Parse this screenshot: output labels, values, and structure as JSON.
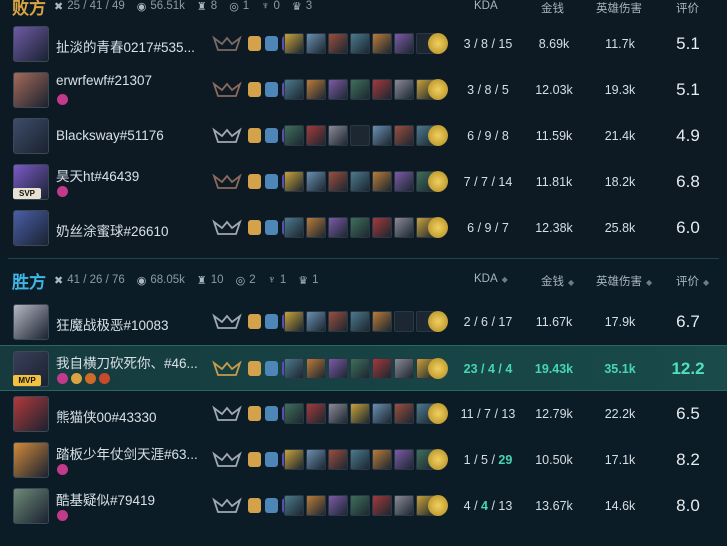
{
  "lose_team": {
    "label": "败方",
    "kills": "25 / 41 / 49",
    "gold": "56.51k",
    "towers": "8",
    "inhibitors": "1",
    "barons": "0",
    "dragons": "3",
    "columns": {
      "kda": "KDA",
      "gold": "金钱",
      "damage": "英雄伤害",
      "score": "评价"
    },
    "players": [
      {
        "name": "扯淡的青春0217#535...",
        "kda": "3 / 8 / 15",
        "gold": "8.69k",
        "damage": "11.7k",
        "score": "5.1",
        "avatar_color": "#6e5aa6",
        "rank_color": "#7a6a66"
      },
      {
        "name": "erwrfewf#21307",
        "kda": "3 / 8 / 5",
        "gold": "12.03k",
        "damage": "19.3k",
        "score": "5.1",
        "avatar_color": "#a66a58",
        "rank_color": "#8a6a5c"
      },
      {
        "name": "Blacksway#51176",
        "kda": "6 / 9 / 8",
        "gold": "11.59k",
        "damage": "21.4k",
        "score": "4.9",
        "avatar_color": "#3d4c68",
        "rank_color": "#a0a8b4"
      },
      {
        "name": "昊天ht#46439",
        "kda": "7 / 7 / 14",
        "gold": "11.81k",
        "damage": "18.2k",
        "score": "6.8",
        "avatar_color": "#7b5ac8",
        "rank_color": "#8a6a5c",
        "badge": "SVP"
      },
      {
        "name": "奶丝涂蜜球#26610",
        "kda": "6 / 9 / 7",
        "gold": "12.38k",
        "damage": "25.8k",
        "score": "6.0",
        "avatar_color": "#4a5ea8",
        "rank_color": "#a0a8b4"
      }
    ]
  },
  "win_team": {
    "label": "胜方",
    "kills": "41 / 26 / 76",
    "gold": "68.05k",
    "towers": "10",
    "inhibitors": "2",
    "barons": "1",
    "dragons": "1",
    "columns": {
      "kda": "KDA",
      "gold": "金钱",
      "damage": "英雄伤害",
      "score": "评价"
    },
    "players": [
      {
        "name": "狂魔战极恶#10083",
        "kda": "2 / 6 / 17",
        "gold": "11.67k",
        "damage": "17.9k",
        "score": "6.7",
        "avatar_color": "#b7b7c4",
        "rank_color": "#a0a8b4"
      },
      {
        "name": "我自横刀砍死你、#46...",
        "kda": "23 / 4 / 4",
        "gold": "19.43k",
        "damage": "35.1k",
        "score": "12.2",
        "avatar_color": "#3a3f5a",
        "rank_color": "#c99b4a",
        "badge": "MVP"
      },
      {
        "name": "熊猫侠00#43330",
        "kda": "11 / 7 / 13",
        "gold": "12.79k",
        "damage": "22.2k",
        "score": "6.5",
        "avatar_color": "#b33a3a",
        "rank_color": "#a0a8b4"
      },
      {
        "name": "踏板少年仗剑天涯#63...",
        "kda_k": "1",
        "kda_d": "5",
        "kda_a": "29",
        "gold": "10.50k",
        "damage": "17.1k",
        "score": "8.2",
        "avatar_color": "#d28a3a",
        "rank_color": "#a0a8b4"
      },
      {
        "name": "酷基疑似#79419",
        "kda_k": "4",
        "kda_d": "4",
        "kda_a": "13",
        "gold": "13.67k",
        "damage": "14.6k",
        "score": "8.0",
        "avatar_color": "#6e8a78",
        "rank_color": "#a0a8b4"
      }
    ]
  },
  "icons": {
    "kills": "crossed-swords-icon",
    "gold": "gold-coins-icon",
    "towers": "tower-icon",
    "inhibitors": "inhibitor-icon",
    "barons": "baron-icon",
    "dragons": "dragon-icon"
  }
}
